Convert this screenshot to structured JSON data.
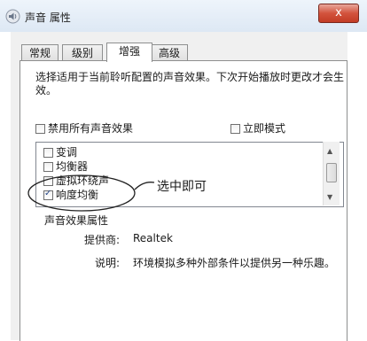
{
  "window": {
    "title": "声音 属性",
    "close_label": "x"
  },
  "tabs": [
    {
      "label": "常规"
    },
    {
      "label": "级别"
    },
    {
      "label": "增强",
      "active": true
    },
    {
      "label": "高级"
    }
  ],
  "description": "选择适用于当前聆听配置的声音效果。下次开始播放时更改才会生效。",
  "options": {
    "disable_all": {
      "label": "禁用所有声音效果",
      "checked": false
    },
    "immediate_mode": {
      "label": "立即模式",
      "checked": false
    }
  },
  "effects": [
    {
      "label": "变调",
      "checked": false
    },
    {
      "label": "均衡器",
      "checked": false
    },
    {
      "label": "虚拟环绕声",
      "checked": false
    },
    {
      "label": "响度均衡",
      "checked": true
    }
  ],
  "annotation": "选中即可",
  "properties": {
    "group_label": "声音效果属性",
    "provider_label": "提供商:",
    "provider_value": "Realtek",
    "description_label": "说明:",
    "description_value": "环境模拟多种外部条件以提供另一种乐趣。"
  }
}
